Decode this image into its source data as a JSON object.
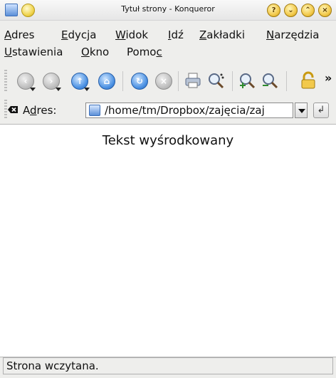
{
  "window": {
    "title": "Tytuł strony - Konqueror",
    "title_buttons": {
      "help": "?",
      "minimize": "⌄",
      "maximize": "⌃",
      "close": "×"
    }
  },
  "menubar": {
    "items": [
      {
        "prefix": "",
        "mnemonic": "A",
        "rest": "dres"
      },
      {
        "prefix": "",
        "mnemonic": "E",
        "rest": "dycja"
      },
      {
        "prefix": "",
        "mnemonic": "W",
        "rest": "idok"
      },
      {
        "prefix": "",
        "mnemonic": "I",
        "rest": "dź"
      },
      {
        "prefix": "",
        "mnemonic": "Z",
        "rest": "akładki"
      },
      {
        "prefix": "",
        "mnemonic": "N",
        "rest": "arzędzia"
      },
      {
        "prefix": "",
        "mnemonic": "U",
        "rest": "stawienia"
      },
      {
        "prefix": "",
        "mnemonic": "O",
        "rest": "kno"
      },
      {
        "prefix": "Pomo",
        "mnemonic": "c",
        "rest": ""
      }
    ]
  },
  "toolbar": {
    "more": "»",
    "icons": [
      "back-icon",
      "forward-icon",
      "up-icon",
      "home-icon",
      "reload-icon",
      "stop-icon",
      "print-icon",
      "find-icon",
      "zoom-in-icon",
      "zoom-out-icon",
      "lock-icon"
    ]
  },
  "location": {
    "label_prefix": "A",
    "label_mnemonic": "d",
    "label_rest": "res:",
    "value": "/home/tm/Dropbox/zajęcia/zaj"
  },
  "content": {
    "heading": "Tekst wyśrodkowany"
  },
  "status": {
    "text": "Strona wczytana."
  },
  "colors": {
    "accent_blue": "#4a90e2",
    "titlebar_button": "#f2c94c"
  }
}
